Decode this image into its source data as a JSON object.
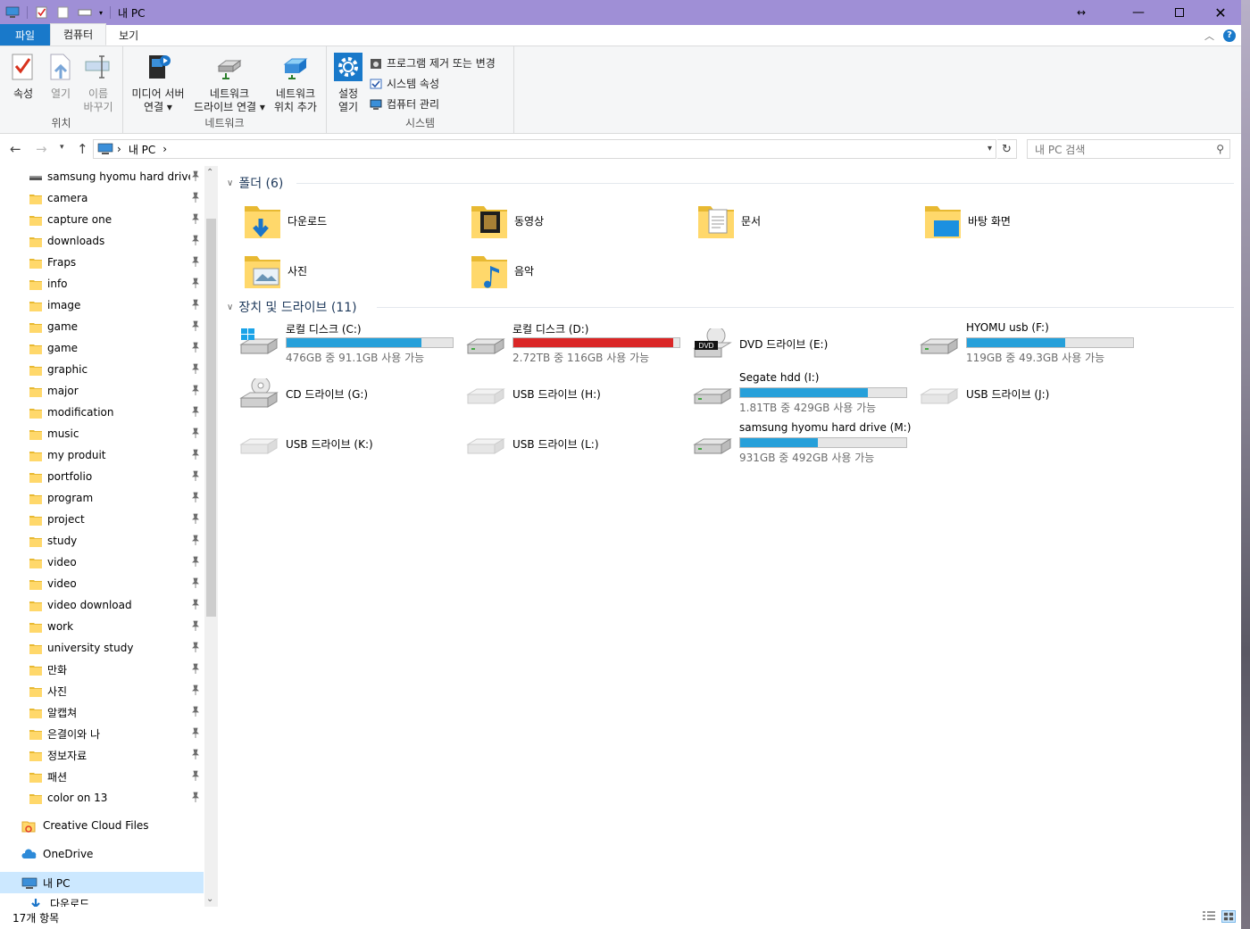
{
  "window": {
    "title": "내 PC"
  },
  "tabs": [
    "파일",
    "컴퓨터",
    "보기"
  ],
  "ribbon": {
    "location_group": {
      "label": "위치",
      "buttons": [
        {
          "label1": "속성",
          "label2": "",
          "disabled": false
        },
        {
          "label1": "열기",
          "label2": "",
          "disabled": true
        },
        {
          "label1": "이름",
          "label2": "바꾸기",
          "disabled": true
        }
      ]
    },
    "network_group": {
      "label": "네트워크",
      "buttons": [
        {
          "label1": "미디어 서버",
          "label2": "연결 ▾"
        },
        {
          "label1": "네트워크",
          "label2": "드라이브 연결 ▾"
        },
        {
          "label1": "네트워크",
          "label2": "위치 추가"
        }
      ]
    },
    "system_group": {
      "label": "시스템",
      "settings": {
        "label1": "설정",
        "label2": "열기"
      },
      "small": [
        "프로그램 제거 또는 변경",
        "시스템 속성",
        "컴퓨터 관리"
      ]
    }
  },
  "address": {
    "crumb": "내 PC",
    "search_placeholder": "내 PC 검색"
  },
  "sidebar": {
    "quick": [
      {
        "label": "samsung hyomu hard drive (M",
        "kind": "drive"
      },
      {
        "label": "camera"
      },
      {
        "label": "capture one"
      },
      {
        "label": "downloads"
      },
      {
        "label": "Fraps"
      },
      {
        "label": "info"
      },
      {
        "label": "image"
      },
      {
        "label": "game"
      },
      {
        "label": "game"
      },
      {
        "label": "graphic"
      },
      {
        "label": "major"
      },
      {
        "label": "modification"
      },
      {
        "label": "music"
      },
      {
        "label": "my produit"
      },
      {
        "label": "portfolio"
      },
      {
        "label": "program"
      },
      {
        "label": "project"
      },
      {
        "label": "study"
      },
      {
        "label": "video"
      },
      {
        "label": "video"
      },
      {
        "label": "video download"
      },
      {
        "label": "work"
      },
      {
        "label": "university study"
      },
      {
        "label": "만화"
      },
      {
        "label": "사진"
      },
      {
        "label": "알캡쳐"
      },
      {
        "label": "은결이와 나"
      },
      {
        "label": "정보자료"
      },
      {
        "label": "패션"
      },
      {
        "label": "color on 13"
      }
    ],
    "creative_cloud": "Creative Cloud Files",
    "onedrive": "OneDrive",
    "this_pc": "내 PC",
    "downloads_child": "다운로드"
  },
  "folders": {
    "heading": "폴더 (6)",
    "items": [
      {
        "name": "다운로드",
        "icon": "downloads-folder-icon"
      },
      {
        "name": "동영상",
        "icon": "videos-folder-icon"
      },
      {
        "name": "문서",
        "icon": "documents-folder-icon"
      },
      {
        "name": "바탕 화면",
        "icon": "desktop-folder-icon"
      },
      {
        "name": "사진",
        "icon": "pictures-folder-icon"
      },
      {
        "name": "음악",
        "icon": "music-folder-icon"
      }
    ]
  },
  "drives": {
    "heading": "장치 및 드라이브 (11)",
    "items": [
      {
        "name": "로컬 디스크 (C:)",
        "free": "476GB 중 91.1GB 사용 가능",
        "used": 0.81,
        "icon": "windows-drive-icon"
      },
      {
        "name": "로컬 디스크 (D:)",
        "free": "2.72TB 중 116GB 사용 가능",
        "used": 0.96,
        "warn": true,
        "icon": "hdd-icon"
      },
      {
        "name": "DVD 드라이브 (E:)",
        "free": "",
        "icon": "dvd-drive-icon"
      },
      {
        "name": "HYOMU usb (F:)",
        "free": "119GB 중 49.3GB 사용 가능",
        "used": 0.59,
        "icon": "hdd-icon"
      },
      {
        "name": "CD 드라이브 (G:)",
        "free": "",
        "icon": "cd-drive-icon"
      },
      {
        "name": "USB 드라이브 (H:)",
        "free": "",
        "icon": "usb-drive-icon"
      },
      {
        "name": "Segate hdd (I:)",
        "free": "1.81TB 중 429GB 사용 가능",
        "used": 0.77,
        "icon": "hdd-icon"
      },
      {
        "name": "USB 드라이브 (J:)",
        "free": "",
        "icon": "usb-drive-icon"
      },
      {
        "name": "USB 드라이브 (K:)",
        "free": "",
        "icon": "usb-drive-icon"
      },
      {
        "name": "USB 드라이브 (L:)",
        "free": "",
        "icon": "usb-drive-icon"
      },
      {
        "name": "samsung hyomu hard drive (M:)",
        "free": "931GB 중 492GB 사용 가능",
        "used": 0.47,
        "icon": "hdd-icon"
      }
    ]
  },
  "status": {
    "count": "17개 항목"
  },
  "colors": {
    "accent": "#1979ca",
    "titlebar": "#9f8fd6",
    "usage": "#26a0da",
    "usage_full": "#da2626"
  }
}
